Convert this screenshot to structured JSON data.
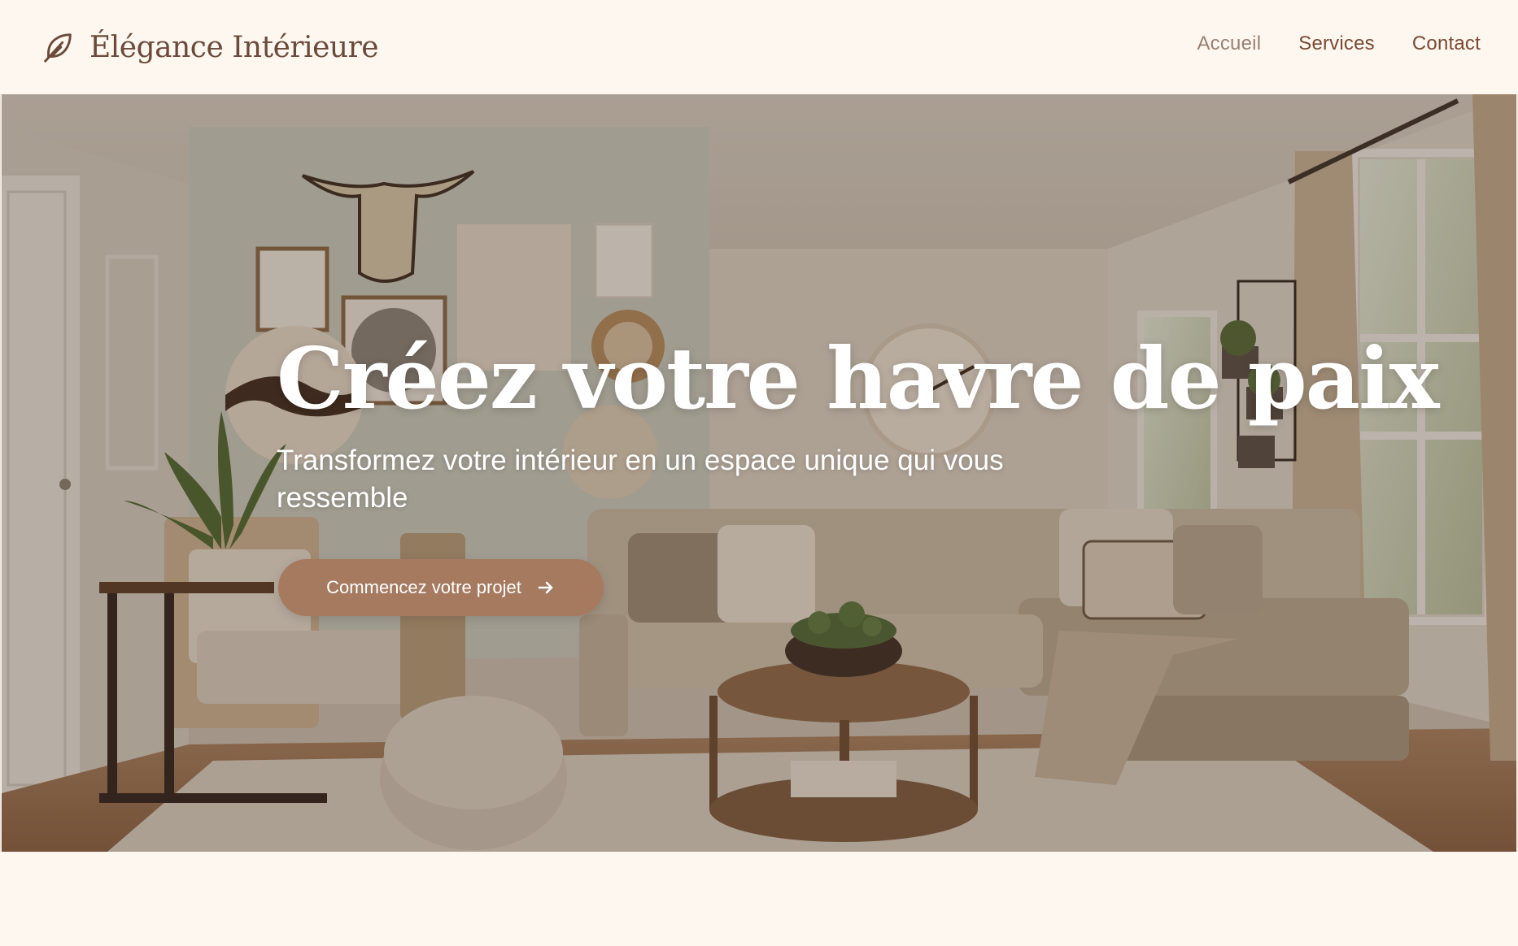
{
  "header": {
    "brand_name": "Élégance Intérieure",
    "brand_icon": "feather-icon",
    "nav": [
      {
        "label": "Accueil",
        "active": true
      },
      {
        "label": "Services",
        "active": false
      },
      {
        "label": "Contact",
        "active": false
      }
    ]
  },
  "hero": {
    "title": "Créez votre havre de paix",
    "subtitle": "Transformez votre intérieur en un espace unique qui vous ressemble",
    "cta_label": "Commencez votre projet",
    "cta_icon": "arrow-right-icon",
    "background": "living-room-photo"
  },
  "colors": {
    "page_bg": "#fdf7f0",
    "brand_text": "#6b4a3a",
    "nav_text": "#7a4a33",
    "nav_active": "#9b8070",
    "cta_bg": "#a57a5f"
  }
}
